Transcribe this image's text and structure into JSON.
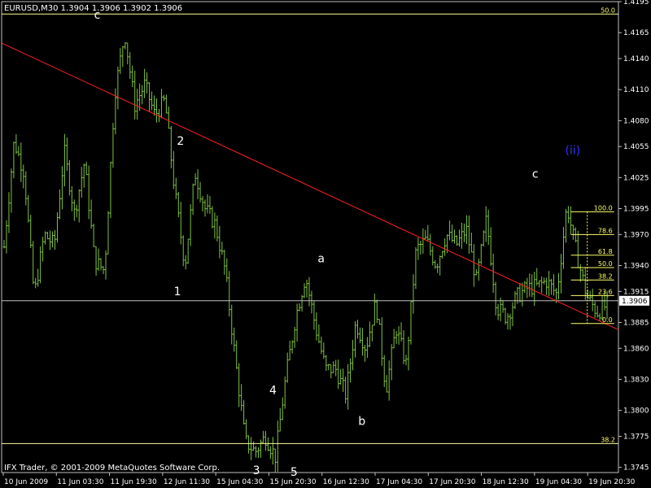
{
  "header": {
    "text": "EURUSD,M30  1.3904 1.3906 1.3902 1.3906"
  },
  "footer": {
    "copyright": "IFX Trader, © 2001-2009 MetaQuotes Software Corp."
  },
  "chart_data": {
    "type": "ohlc",
    "symbol": "EURUSD",
    "timeframe": "M30",
    "ylim": [
      1.374,
      1.4195
    ],
    "y_ticks": [
      "1.4195",
      "1.4165",
      "1.4140",
      "1.4110",
      "1.4080",
      "1.4055",
      "1.4025",
      "1.3995",
      "1.3970",
      "1.3940",
      "1.3915",
      "1.3885",
      "1.3860",
      "1.3830",
      "1.3800",
      "1.3775",
      "1.3745"
    ],
    "x_ticks": [
      "10 Jun 2009",
      "11 Jun 03:30",
      "11 Jun 19:30",
      "12 Jun 11:30",
      "15 Jun 04:30",
      "15 Jun 20:30",
      "16 Jun 12:30",
      "17 Jun 04:30",
      "17 Jun 20:30",
      "18 Jun 12:30",
      "19 Jun 04:30",
      "19 Jun 20:30"
    ],
    "bar_color": "#7fc241",
    "current_price": {
      "value": 1.3906,
      "label": "1.3906",
      "color": "#c0c0c0"
    },
    "path_values": [
      1.3958,
      1.406,
      1.403,
      1.391,
      1.397,
      1.396,
      1.405,
      1.399,
      1.404,
      1.3945,
      1.3935,
      1.4105,
      1.4165,
      1.4095,
      1.4115,
      1.4085,
      1.41,
      1.401,
      1.394,
      1.403,
      1.3995,
      1.398,
      1.3935,
      1.385,
      1.377,
      1.376,
      1.3775,
      1.3755,
      1.383,
      1.389,
      1.393,
      1.388,
      1.384,
      1.384,
      1.3815,
      1.3885,
      1.386,
      1.3905,
      1.382,
      1.388,
      1.3845,
      1.3955,
      1.3965,
      1.394,
      1.397,
      1.396,
      1.3975,
      1.3925,
      1.3985,
      1.39,
      1.389,
      1.391,
      1.3918,
      1.392,
      1.3925,
      1.3912,
      1.3998,
      1.395,
      1.391,
      1.3895,
      1.3902
    ],
    "fib_levels_right": [
      {
        "label": "100.0",
        "value": 1.3992
      },
      {
        "label": "78.6",
        "value": 1.397
      },
      {
        "label": "61.8",
        "value": 1.395
      },
      {
        "label": "50.0",
        "value": 1.3938
      },
      {
        "label": "38.2",
        "value": 1.3926
      },
      {
        "label": "23.6",
        "value": 1.3911
      },
      {
        "label": "0.0",
        "value": 1.3884
      }
    ],
    "fib_levels_long": [
      {
        "label": "50.0",
        "value": 1.4183
      },
      {
        "label": "38.2",
        "value": 1.3768
      }
    ],
    "trendline": {
      "from": {
        "x": "10 Jun 2009",
        "y": 1.4155
      },
      "to_y": 1.3878,
      "color": "#ff2020"
    },
    "wave_labels": [
      {
        "text": "c",
        "color": "#ffffff"
      },
      {
        "text": "2",
        "color": "#ffffff"
      },
      {
        "text": "1",
        "color": "#ffffff"
      },
      {
        "text": "3",
        "color": "#ffffff"
      },
      {
        "text": "4",
        "color": "#ffffff"
      },
      {
        "text": "5",
        "color": "#ffffff"
      },
      {
        "text": "a",
        "color": "#ffffff"
      },
      {
        "text": "b",
        "color": "#ffffff"
      },
      {
        "text": "c",
        "color": "#ffffff"
      },
      {
        "text": "(ii)",
        "color": "#3333ff"
      }
    ]
  }
}
